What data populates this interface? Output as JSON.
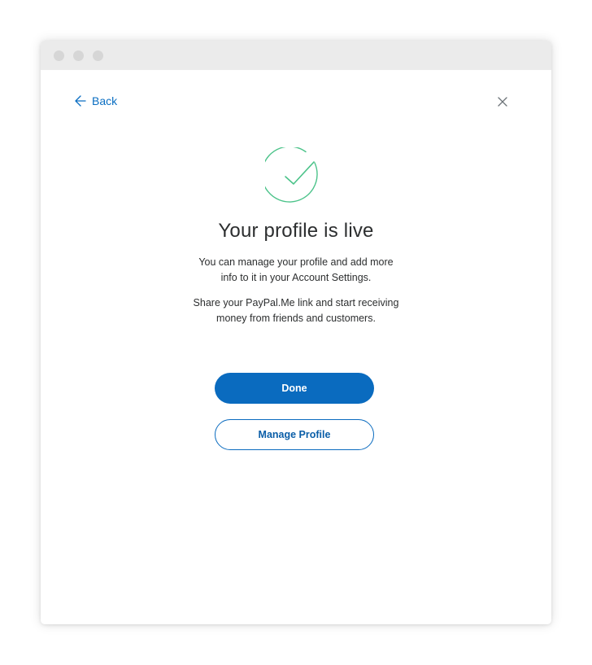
{
  "window": {
    "controls": [
      "window-dot",
      "window-dot",
      "window-dot"
    ]
  },
  "nav": {
    "back_label": "Back",
    "back_icon": "arrow-left-icon",
    "close_icon": "close-icon"
  },
  "status": {
    "icon": "check-circle-icon",
    "title": "Your profile is live",
    "message_1": "You can manage your profile and add more info to it in your Account Settings.",
    "message_2": "Share your PayPal.Me link and start receiving money from friends and customers."
  },
  "actions": {
    "done_label": "Done",
    "manage_label": "Manage Profile"
  },
  "colors": {
    "accent": "#0a6bbf",
    "success": "#4cc38a",
    "titlebar": "#ebebeb"
  }
}
